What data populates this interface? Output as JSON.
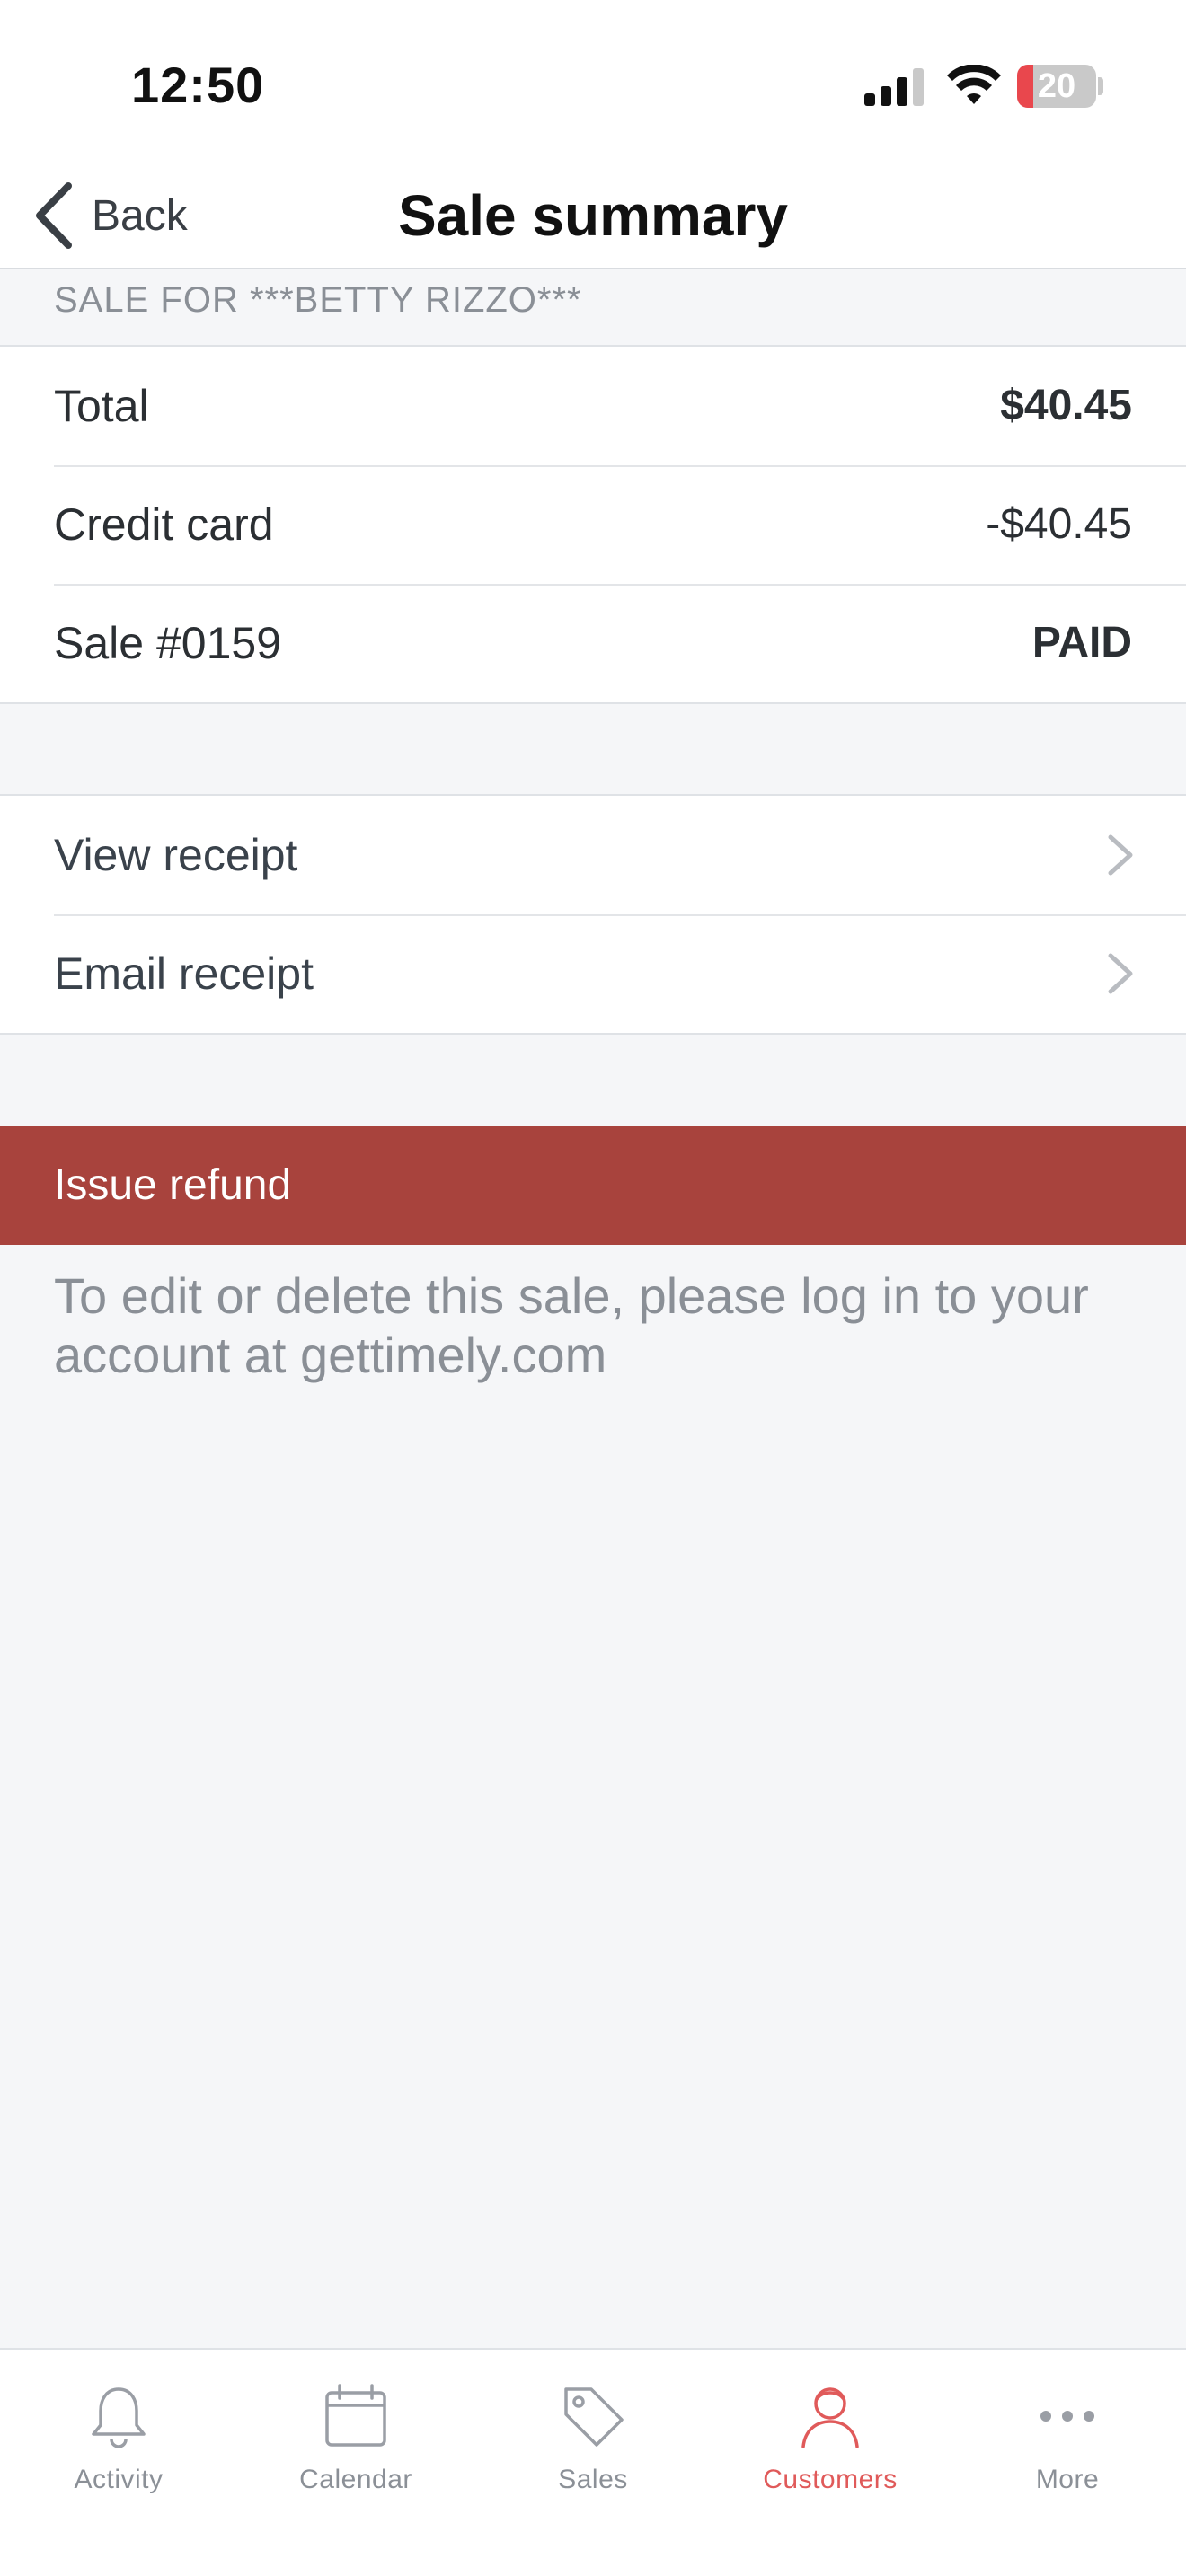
{
  "status_bar": {
    "time": "12:50",
    "battery_level": "20",
    "battery_fraction": 0.2
  },
  "nav": {
    "back_label": "Back",
    "title": "Sale summary"
  },
  "section_header": "SALE FOR ***BETTY RIZZO***",
  "summary_rows": [
    {
      "label": "Total",
      "value": "$40.45"
    },
    {
      "label": "Credit card",
      "value": "-$40.45"
    },
    {
      "label": "Sale #0159",
      "value": "PAID"
    }
  ],
  "receipt_actions": [
    {
      "label": "View receipt"
    },
    {
      "label": "Email receipt"
    }
  ],
  "refund": {
    "button_label": "Issue refund",
    "note": "To edit or delete this sale, please log in to your account at gettimely.com"
  },
  "tab_bar": {
    "tabs": [
      {
        "label": "Activity",
        "icon": "bell-icon"
      },
      {
        "label": "Calendar",
        "icon": "calendar-icon"
      },
      {
        "label": "Sales",
        "icon": "tag-icon"
      },
      {
        "label": "Customers",
        "icon": "customer-icon",
        "active": true
      },
      {
        "label": "More",
        "icon": "more-icon"
      }
    ]
  },
  "colors": {
    "accent": "#e05a5a",
    "refund_background": "#a8433d",
    "battery_low": "#e9474d"
  }
}
